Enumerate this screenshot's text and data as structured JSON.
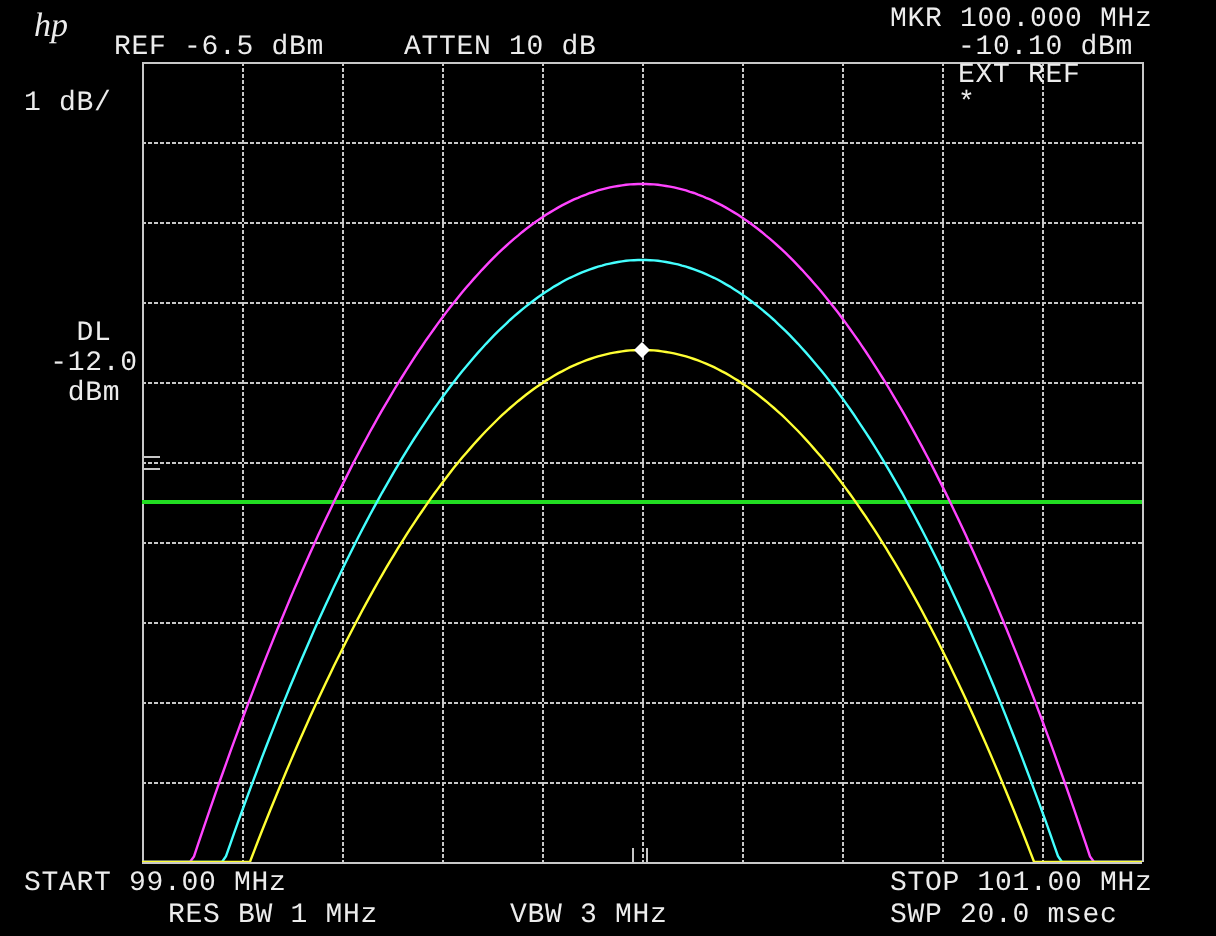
{
  "header": {
    "logo": "hp",
    "reference": "REF -6.5 dBm",
    "attenuation": "ATTEN 10 dB"
  },
  "marker": {
    "frequency": "MKR 100.000 MHz",
    "amplitude": "-10.10 dBm"
  },
  "status": {
    "ext_ref": "EXT REF",
    "flag": "*"
  },
  "scale": "1 dB/",
  "display_line": {
    "label": "DL",
    "value": "-12.0",
    "unit": "dBm"
  },
  "footer": {
    "start": "START 99.00 MHz",
    "res_bw": "RES BW 1 MHz",
    "vbw": "VBW 3 MHz",
    "stop": "STOP 101.00 MHz",
    "sweep": "SWP 20.0 msec"
  }
}
